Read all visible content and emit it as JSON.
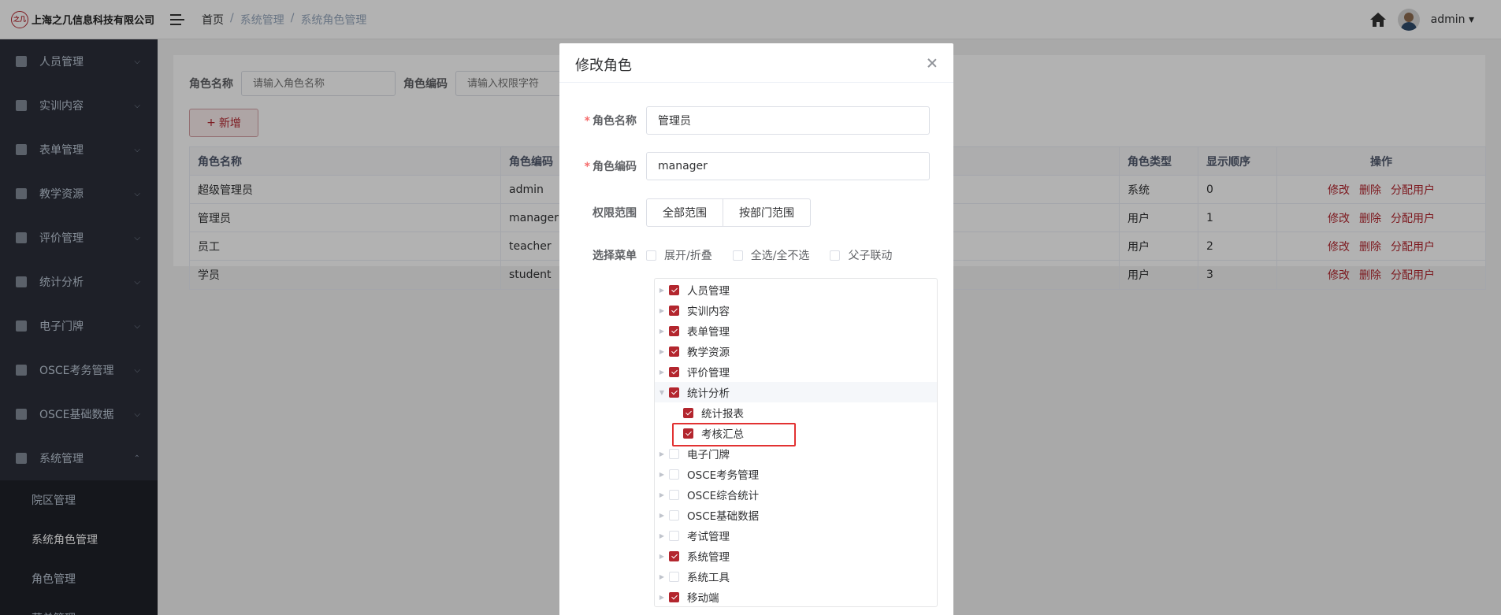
{
  "header": {
    "company": "上海之几信息科技有限公司",
    "logo_text": "之几",
    "breadcrumb": [
      "首页",
      "系统管理",
      "系统角色管理"
    ],
    "user": "admin"
  },
  "sidebar": {
    "items": [
      {
        "label": "人员管理",
        "icon": "user-icon"
      },
      {
        "label": "实训内容",
        "icon": "content-icon"
      },
      {
        "label": "表单管理",
        "icon": "form-icon"
      },
      {
        "label": "教学资源",
        "icon": "book-icon"
      },
      {
        "label": "评价管理",
        "icon": "evaluate-icon"
      },
      {
        "label": "统计分析",
        "icon": "chart-icon"
      },
      {
        "label": "电子门牌",
        "icon": "monitor-icon"
      },
      {
        "label": "OSCE考务管理",
        "icon": "exam-icon"
      },
      {
        "label": "OSCE基础数据",
        "icon": "data-icon"
      },
      {
        "label": "系统管理",
        "icon": "gear-icon"
      }
    ],
    "submenu": [
      "院区管理",
      "系统角色管理",
      "角色管理",
      "菜单管理"
    ]
  },
  "search": {
    "name_label": "角色名称",
    "name_placeholder": "请输入角色名称",
    "code_label": "角色编码",
    "code_placeholder": "请输入权限字符"
  },
  "add_button": "新增",
  "table": {
    "headers": [
      "角色名称",
      "角色编码",
      "角色类型",
      "显示顺序",
      "操作"
    ],
    "rows": [
      {
        "name": "超级管理员",
        "code": "admin",
        "type": "系统",
        "order": "0"
      },
      {
        "name": "管理员",
        "code": "manager",
        "type": "用户",
        "order": "1"
      },
      {
        "name": "员工",
        "code": "teacher",
        "type": "用户",
        "order": "2"
      },
      {
        "name": "学员",
        "code": "student",
        "type": "用户",
        "order": "3"
      }
    ],
    "actions": [
      "修改",
      "删除",
      "分配用户"
    ]
  },
  "dialog": {
    "title": "修改角色",
    "role_name_label": "角色名称",
    "role_name_value": "管理员",
    "role_code_label": "角色编码",
    "role_code_value": "manager",
    "scope_label": "权限范围",
    "scope_options": [
      "全部范围",
      "按部门范围"
    ],
    "menu_label": "选择菜单",
    "menu_options": [
      "展开/折叠",
      "全选/全不选",
      "父子联动"
    ],
    "tree": [
      {
        "label": "人员管理",
        "checked": true
      },
      {
        "label": "实训内容",
        "checked": true
      },
      {
        "label": "表单管理",
        "checked": true
      },
      {
        "label": "教学资源",
        "checked": true
      },
      {
        "label": "评价管理",
        "checked": true
      },
      {
        "label": "统计分析",
        "checked": true,
        "expanded": true
      },
      {
        "label": "统计报表",
        "checked": true,
        "child": true
      },
      {
        "label": "考核汇总",
        "checked": true,
        "child": true,
        "highlighted": true
      },
      {
        "label": "电子门牌",
        "checked": false
      },
      {
        "label": "OSCE考务管理",
        "checked": false
      },
      {
        "label": "OSCE综合统计",
        "checked": false
      },
      {
        "label": "OSCE基础数据",
        "checked": false
      },
      {
        "label": "考试管理",
        "checked": false
      },
      {
        "label": "系统管理",
        "checked": true
      },
      {
        "label": "系统工具",
        "checked": false
      },
      {
        "label": "移动端",
        "checked": true
      }
    ]
  },
  "colors": {
    "accent": "#b3262e",
    "sidebar_bg": "#2b2f3a",
    "highlight": "#e23232"
  }
}
